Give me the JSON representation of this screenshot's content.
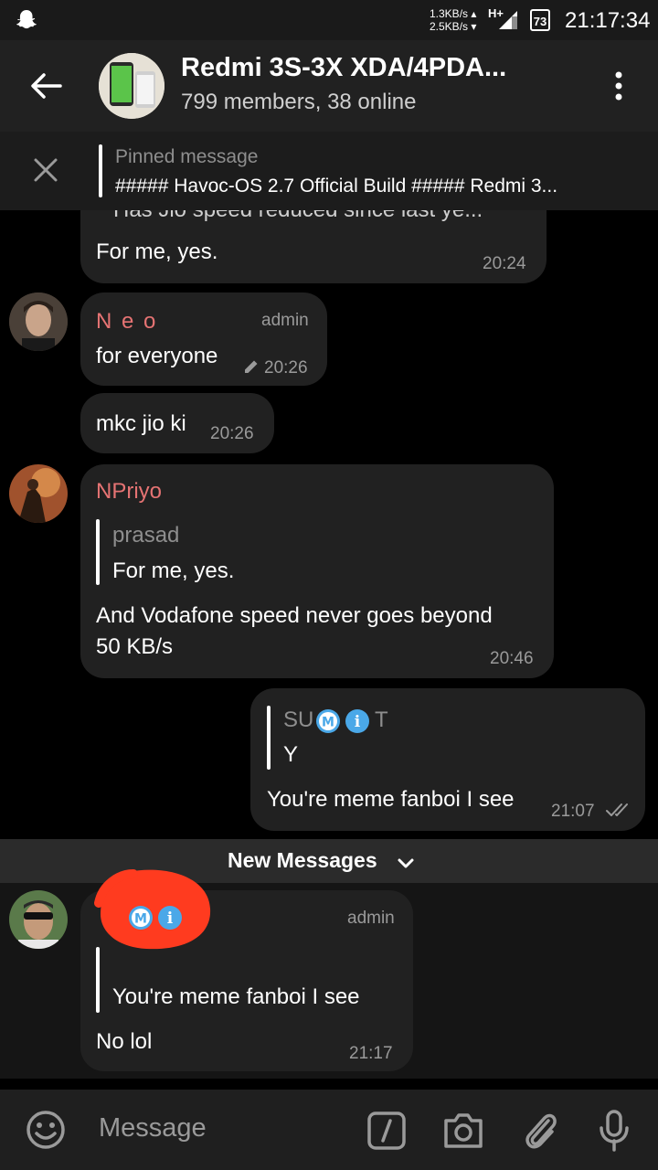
{
  "status_bar": {
    "speed_up": "1.3KB/s",
    "speed_down": "2.5KB/s",
    "network": "H+",
    "battery": "73",
    "time": "21:17:34"
  },
  "header": {
    "title": "Redmi 3S-3X XDA/4PDA...",
    "subtitle": "799 members, 38 online"
  },
  "pinned": {
    "label": "Pinned message",
    "text": "##### Havoc-OS 2.7 Official Build #####  Redmi 3..."
  },
  "messages": [
    {
      "partial_text": "Has Jio speed reduced since last ye...",
      "text": "For me, yes.",
      "time": "20:24"
    },
    {
      "sender": "N e o",
      "role": "admin",
      "text": "for everyone",
      "time": "20:26"
    },
    {
      "text": "mkc jio ki",
      "time": "20:26"
    },
    {
      "sender": "NPriyo",
      "quote_name": "prasad",
      "quote_text": "For me, yes.",
      "text_line1": "And Vodafone speed never goes beyond",
      "text_line2": "50 KB/s",
      "time": "20:46"
    },
    {
      "quote_name_prefix": "SU",
      "quote_name_suffix": "T",
      "quote_text": "Y",
      "text": "You're meme fanboi I see",
      "time": "21:07"
    },
    {
      "role": "admin",
      "quote_text": "You're meme fanboi I see",
      "text": "No lol",
      "time": "21:17"
    }
  ],
  "new_messages_label": "New Messages",
  "input": {
    "placeholder": "Message"
  },
  "colors": {
    "sender_name": "#e57373",
    "badge_blue": "#4aa8e8",
    "redaction": "#ff3b1f"
  },
  "icons": [
    "snapchat-icon",
    "back-arrow-icon",
    "more-vert-icon",
    "close-icon",
    "pencil-icon",
    "double-check-icon",
    "chevron-down-icon",
    "emoji-icon",
    "bot-command-icon",
    "camera-icon",
    "attach-icon",
    "mic-icon"
  ]
}
